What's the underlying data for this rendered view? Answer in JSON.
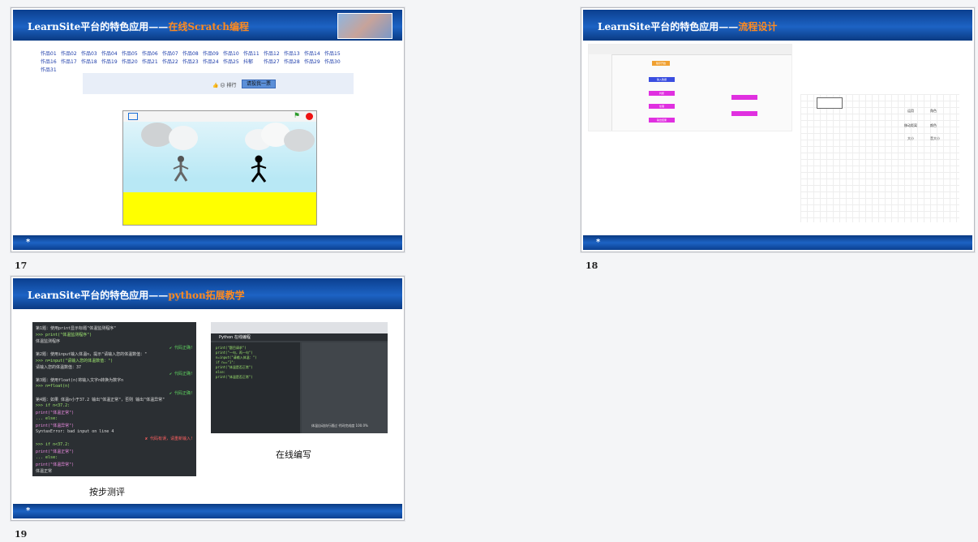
{
  "slides": [
    {
      "number": "17",
      "title_prefix": "LearnSite平台的特色应用——",
      "title_highlight": "在线Scratch编程"
    },
    {
      "number": "18",
      "title_prefix": "LearnSite平台的特色应用——",
      "title_highlight": "流程设计"
    },
    {
      "number": "19",
      "title_prefix": "LearnSite平台的特色应用——",
      "title_highlight": "python拓展教学"
    }
  ],
  "footer_star": "*",
  "scratch": {
    "works": [
      "作品01",
      "作品02",
      "作品03",
      "作品04",
      "作品05",
      "作品06",
      "作品07",
      "作品08",
      "作品09",
      "作品10",
      "作品11",
      "作品12",
      "作品13",
      "作品14",
      "作品15",
      "作品16",
      "作品17",
      "作品18",
      "作品19",
      "作品20",
      "作品21",
      "作品22",
      "作品23",
      "作品24",
      "作品25",
      "抖郁",
      "作品27",
      "作品28",
      "作品29",
      "作品30",
      "作品31"
    ],
    "vote_label": "👍 😐 排行",
    "vote_button": "请投我一票"
  },
  "flow": {
    "nodes": [
      "程序开始",
      "输入数据",
      "判断",
      "处理",
      "输出结果"
    ],
    "side_labels": [
      [
        "运用",
        "角色"
      ],
      [
        "移动距离",
        "颜色"
      ],
      [
        "大小",
        "音大小"
      ]
    ]
  },
  "python": {
    "caption_left": "按步测评",
    "caption_right": "在线编写",
    "left_lines": [
      {
        "t": "第1题：使用print显示标题\"体温监测程序\"",
        "c": "#ddd"
      },
      {
        "t": ">>> print(\"体温监测程序\")",
        "c": "#9fe870"
      },
      {
        "t": "体温监测程序",
        "c": "#ddd"
      },
      {
        "t": "✔ 代码正确!",
        "c": "#5fd35f"
      },
      {
        "t": "第2题：使用input输入体温n，提示\"请输入您的体温数值：\"",
        "c": "#ddd"
      },
      {
        "t": ">>> n=input(\"请输入您的体温数值：\")",
        "c": "#9fe870"
      },
      {
        "t": "请输入您的体温数值：37",
        "c": "#ddd"
      },
      {
        "t": "✔ 代码正确!",
        "c": "#5fd35f"
      },
      {
        "t": "第3题：使用float(n)将输入文字n转换为数字n",
        "c": "#ddd"
      },
      {
        "t": ">>> n=float(n)",
        "c": "#9fe870"
      },
      {
        "t": "✔ 代码正确!",
        "c": "#5fd35f"
      },
      {
        "t": "第4题：如果 体温n小于37.2 输出\"体温正常\"，否则 输出\"体温异常\"",
        "c": "#ddd"
      },
      {
        "t": ">>> if n<37.2:",
        "c": "#9fe870"
      },
      {
        "t": "      print(\"体温正常\")",
        "c": "#e98adf"
      },
      {
        "t": "... else:",
        "c": "#9fe870"
      },
      {
        "t": "      print(\"体温异常\")",
        "c": "#e98adf"
      },
      {
        "t": "SyntaxError: bad input on line 4",
        "c": "#ddd"
      },
      {
        "t": "✘ 代码有误，请重新输入!",
        "c": "#ff6060"
      },
      {
        "t": ">>> if n<37.2:",
        "c": "#9fe870"
      },
      {
        "t": "      print(\"体温正常\")",
        "c": "#e98adf"
      },
      {
        "t": "... else:",
        "c": "#9fe870"
      },
      {
        "t": "      print(\"体温异常\")",
        "c": "#e98adf"
      },
      {
        "t": "体温正常",
        "c": "#ddd"
      }
    ],
    "editor_title": "Python 在线编程",
    "editor_lines": [
      "print(\"题目请求\")",
      "print(\"一句，再一句\")",
      "n=input(\"请输入体温：\")",
      "if n==\"1\":",
      "    print(\"体温是否正常\")",
      "else:",
      "    print(\"体温是否正常\")"
    ],
    "status": "体温自动执行通过  代码完成度 100.0%"
  },
  "colors": {
    "accent": "#ff8a1f",
    "header": "#1d63c4",
    "ground": "#ffff00"
  }
}
